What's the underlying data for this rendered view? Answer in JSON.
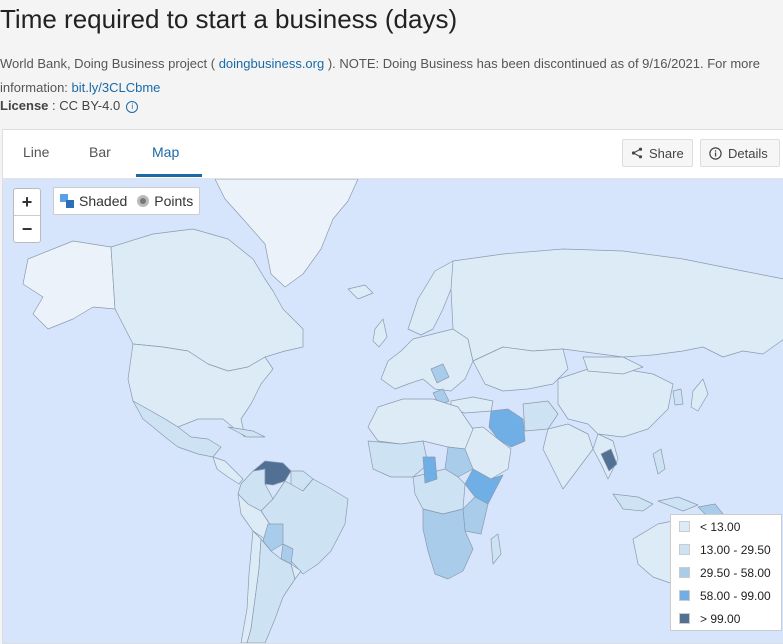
{
  "title": "Time required to start a business (days)",
  "source": {
    "prefix": "World Bank, Doing Business project ( ",
    "link1": "doingbusiness.org",
    "middle": " ). NOTE: Doing Business has been discontinued as of 9/16/2021. For more information: ",
    "link2": "bit.ly/3CLCbme"
  },
  "license": {
    "label": "License",
    "value": " : CC BY-4.0"
  },
  "tabs": [
    {
      "label": "Line"
    },
    {
      "label": "Bar"
    },
    {
      "label": "Map",
      "active": true
    }
  ],
  "buttons": {
    "share": "Share",
    "details": "Details"
  },
  "map": {
    "zoom_in": "+",
    "zoom_out": "−",
    "mode_shaded": "Shaded",
    "mode_points": "Points",
    "ocean_color": "#d6e5fb"
  },
  "legend": [
    {
      "label": "< 13.00",
      "color": "#dcebf6"
    },
    {
      "label": "13.00 - 29.50",
      "color": "#cde2f2"
    },
    {
      "label": "29.50 - 58.00",
      "color": "#a9cceb"
    },
    {
      "label": "58.00 - 99.00",
      "color": "#70aee6"
    },
    {
      "label": "> 99.00",
      "color": "#526f94"
    }
  ]
}
